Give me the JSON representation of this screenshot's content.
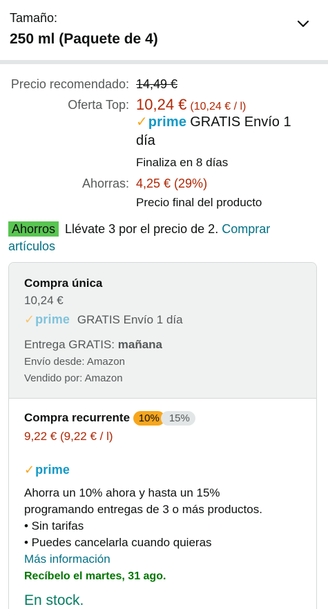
{
  "size": {
    "label": "Tamaño:",
    "value": "250 ml (Paquete de 4)",
    "chevron_icon": "chevron-down-icon"
  },
  "pricing": {
    "list_label": "Precio recomendado:",
    "list_price": "14,49 €",
    "offer_label": "Oferta Top:",
    "offer_price": "10,24 €",
    "offer_unit": "(10,24 € / l)",
    "prime_logo_check": "✓",
    "prime_logo_word": "prime",
    "prime_shipping_line1": "GRATIS Envío 1",
    "prime_shipping_line2": "día",
    "ends_in": "Finaliza en 8 días",
    "savings_label": "Ahorras:",
    "savings_value": "4,25 € (29%)",
    "final_price_note": "Precio final del producto"
  },
  "deal": {
    "badge": "Ahorros",
    "text": "Llévate 3 por el precio de 2.",
    "link": "Comprar artículos"
  },
  "one_time": {
    "title": "Compra única",
    "price": "10,24 €",
    "prime_check": "✓",
    "prime_word": "prime",
    "shipping": "GRATIS Envío 1 día",
    "delivery_prefix": "Entrega GRATIS:",
    "delivery_day": "mañana",
    "ships_from": "Envío desde: Amazon",
    "sold_by": "Vendido por: Amazon"
  },
  "subscribe": {
    "title": "Compra recurrente",
    "discount_selected": "10%",
    "discount_other": "15%",
    "price": "9,22 € (9,22 € / l)",
    "prime_check": "✓",
    "prime_word": "prime",
    "desc_line1": "Ahorra un 10% ahora y hasta un 15%",
    "desc_line2": "programando entregas de 3 o más productos.",
    "bullet1": "• Sin tarifas",
    "bullet2": "• Puedes cancelarla cuando quieras",
    "more_info": "Más información",
    "arrival": "Recíbelo el martes, 31 ago.",
    "stock": "En stock."
  },
  "colors": {
    "price_red": "#b12704",
    "link_teal": "#007185",
    "prime_blue": "#1399c6",
    "prime_orange": "#f7a61c",
    "badge_green": "#59c552",
    "stock_green": "#067d62"
  }
}
